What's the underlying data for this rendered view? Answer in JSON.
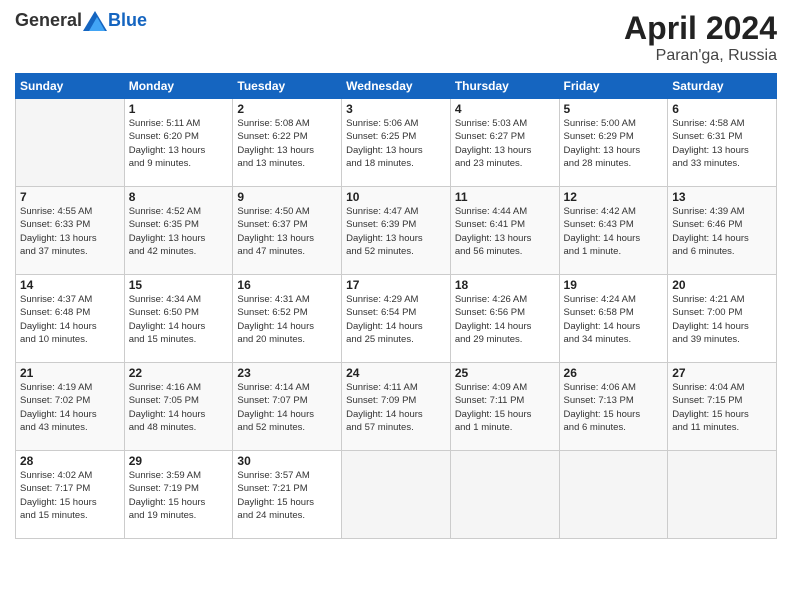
{
  "header": {
    "logo_general": "General",
    "logo_blue": "Blue",
    "title": "April 2024",
    "location": "Paran'ga, Russia"
  },
  "days_of_week": [
    "Sunday",
    "Monday",
    "Tuesday",
    "Wednesday",
    "Thursday",
    "Friday",
    "Saturday"
  ],
  "weeks": [
    [
      {
        "day": "",
        "info": ""
      },
      {
        "day": "1",
        "info": "Sunrise: 5:11 AM\nSunset: 6:20 PM\nDaylight: 13 hours\nand 9 minutes."
      },
      {
        "day": "2",
        "info": "Sunrise: 5:08 AM\nSunset: 6:22 PM\nDaylight: 13 hours\nand 13 minutes."
      },
      {
        "day": "3",
        "info": "Sunrise: 5:06 AM\nSunset: 6:25 PM\nDaylight: 13 hours\nand 18 minutes."
      },
      {
        "day": "4",
        "info": "Sunrise: 5:03 AM\nSunset: 6:27 PM\nDaylight: 13 hours\nand 23 minutes."
      },
      {
        "day": "5",
        "info": "Sunrise: 5:00 AM\nSunset: 6:29 PM\nDaylight: 13 hours\nand 28 minutes."
      },
      {
        "day": "6",
        "info": "Sunrise: 4:58 AM\nSunset: 6:31 PM\nDaylight: 13 hours\nand 33 minutes."
      }
    ],
    [
      {
        "day": "7",
        "info": "Sunrise: 4:55 AM\nSunset: 6:33 PM\nDaylight: 13 hours\nand 37 minutes."
      },
      {
        "day": "8",
        "info": "Sunrise: 4:52 AM\nSunset: 6:35 PM\nDaylight: 13 hours\nand 42 minutes."
      },
      {
        "day": "9",
        "info": "Sunrise: 4:50 AM\nSunset: 6:37 PM\nDaylight: 13 hours\nand 47 minutes."
      },
      {
        "day": "10",
        "info": "Sunrise: 4:47 AM\nSunset: 6:39 PM\nDaylight: 13 hours\nand 52 minutes."
      },
      {
        "day": "11",
        "info": "Sunrise: 4:44 AM\nSunset: 6:41 PM\nDaylight: 13 hours\nand 56 minutes."
      },
      {
        "day": "12",
        "info": "Sunrise: 4:42 AM\nSunset: 6:43 PM\nDaylight: 14 hours\nand 1 minute."
      },
      {
        "day": "13",
        "info": "Sunrise: 4:39 AM\nSunset: 6:46 PM\nDaylight: 14 hours\nand 6 minutes."
      }
    ],
    [
      {
        "day": "14",
        "info": "Sunrise: 4:37 AM\nSunset: 6:48 PM\nDaylight: 14 hours\nand 10 minutes."
      },
      {
        "day": "15",
        "info": "Sunrise: 4:34 AM\nSunset: 6:50 PM\nDaylight: 14 hours\nand 15 minutes."
      },
      {
        "day": "16",
        "info": "Sunrise: 4:31 AM\nSunset: 6:52 PM\nDaylight: 14 hours\nand 20 minutes."
      },
      {
        "day": "17",
        "info": "Sunrise: 4:29 AM\nSunset: 6:54 PM\nDaylight: 14 hours\nand 25 minutes."
      },
      {
        "day": "18",
        "info": "Sunrise: 4:26 AM\nSunset: 6:56 PM\nDaylight: 14 hours\nand 29 minutes."
      },
      {
        "day": "19",
        "info": "Sunrise: 4:24 AM\nSunset: 6:58 PM\nDaylight: 14 hours\nand 34 minutes."
      },
      {
        "day": "20",
        "info": "Sunrise: 4:21 AM\nSunset: 7:00 PM\nDaylight: 14 hours\nand 39 minutes."
      }
    ],
    [
      {
        "day": "21",
        "info": "Sunrise: 4:19 AM\nSunset: 7:02 PM\nDaylight: 14 hours\nand 43 minutes."
      },
      {
        "day": "22",
        "info": "Sunrise: 4:16 AM\nSunset: 7:05 PM\nDaylight: 14 hours\nand 48 minutes."
      },
      {
        "day": "23",
        "info": "Sunrise: 4:14 AM\nSunset: 7:07 PM\nDaylight: 14 hours\nand 52 minutes."
      },
      {
        "day": "24",
        "info": "Sunrise: 4:11 AM\nSunset: 7:09 PM\nDaylight: 14 hours\nand 57 minutes."
      },
      {
        "day": "25",
        "info": "Sunrise: 4:09 AM\nSunset: 7:11 PM\nDaylight: 15 hours\nand 1 minute."
      },
      {
        "day": "26",
        "info": "Sunrise: 4:06 AM\nSunset: 7:13 PM\nDaylight: 15 hours\nand 6 minutes."
      },
      {
        "day": "27",
        "info": "Sunrise: 4:04 AM\nSunset: 7:15 PM\nDaylight: 15 hours\nand 11 minutes."
      }
    ],
    [
      {
        "day": "28",
        "info": "Sunrise: 4:02 AM\nSunset: 7:17 PM\nDaylight: 15 hours\nand 15 minutes."
      },
      {
        "day": "29",
        "info": "Sunrise: 3:59 AM\nSunset: 7:19 PM\nDaylight: 15 hours\nand 19 minutes."
      },
      {
        "day": "30",
        "info": "Sunrise: 3:57 AM\nSunset: 7:21 PM\nDaylight: 15 hours\nand 24 minutes."
      },
      {
        "day": "",
        "info": ""
      },
      {
        "day": "",
        "info": ""
      },
      {
        "day": "",
        "info": ""
      },
      {
        "day": "",
        "info": ""
      }
    ]
  ]
}
